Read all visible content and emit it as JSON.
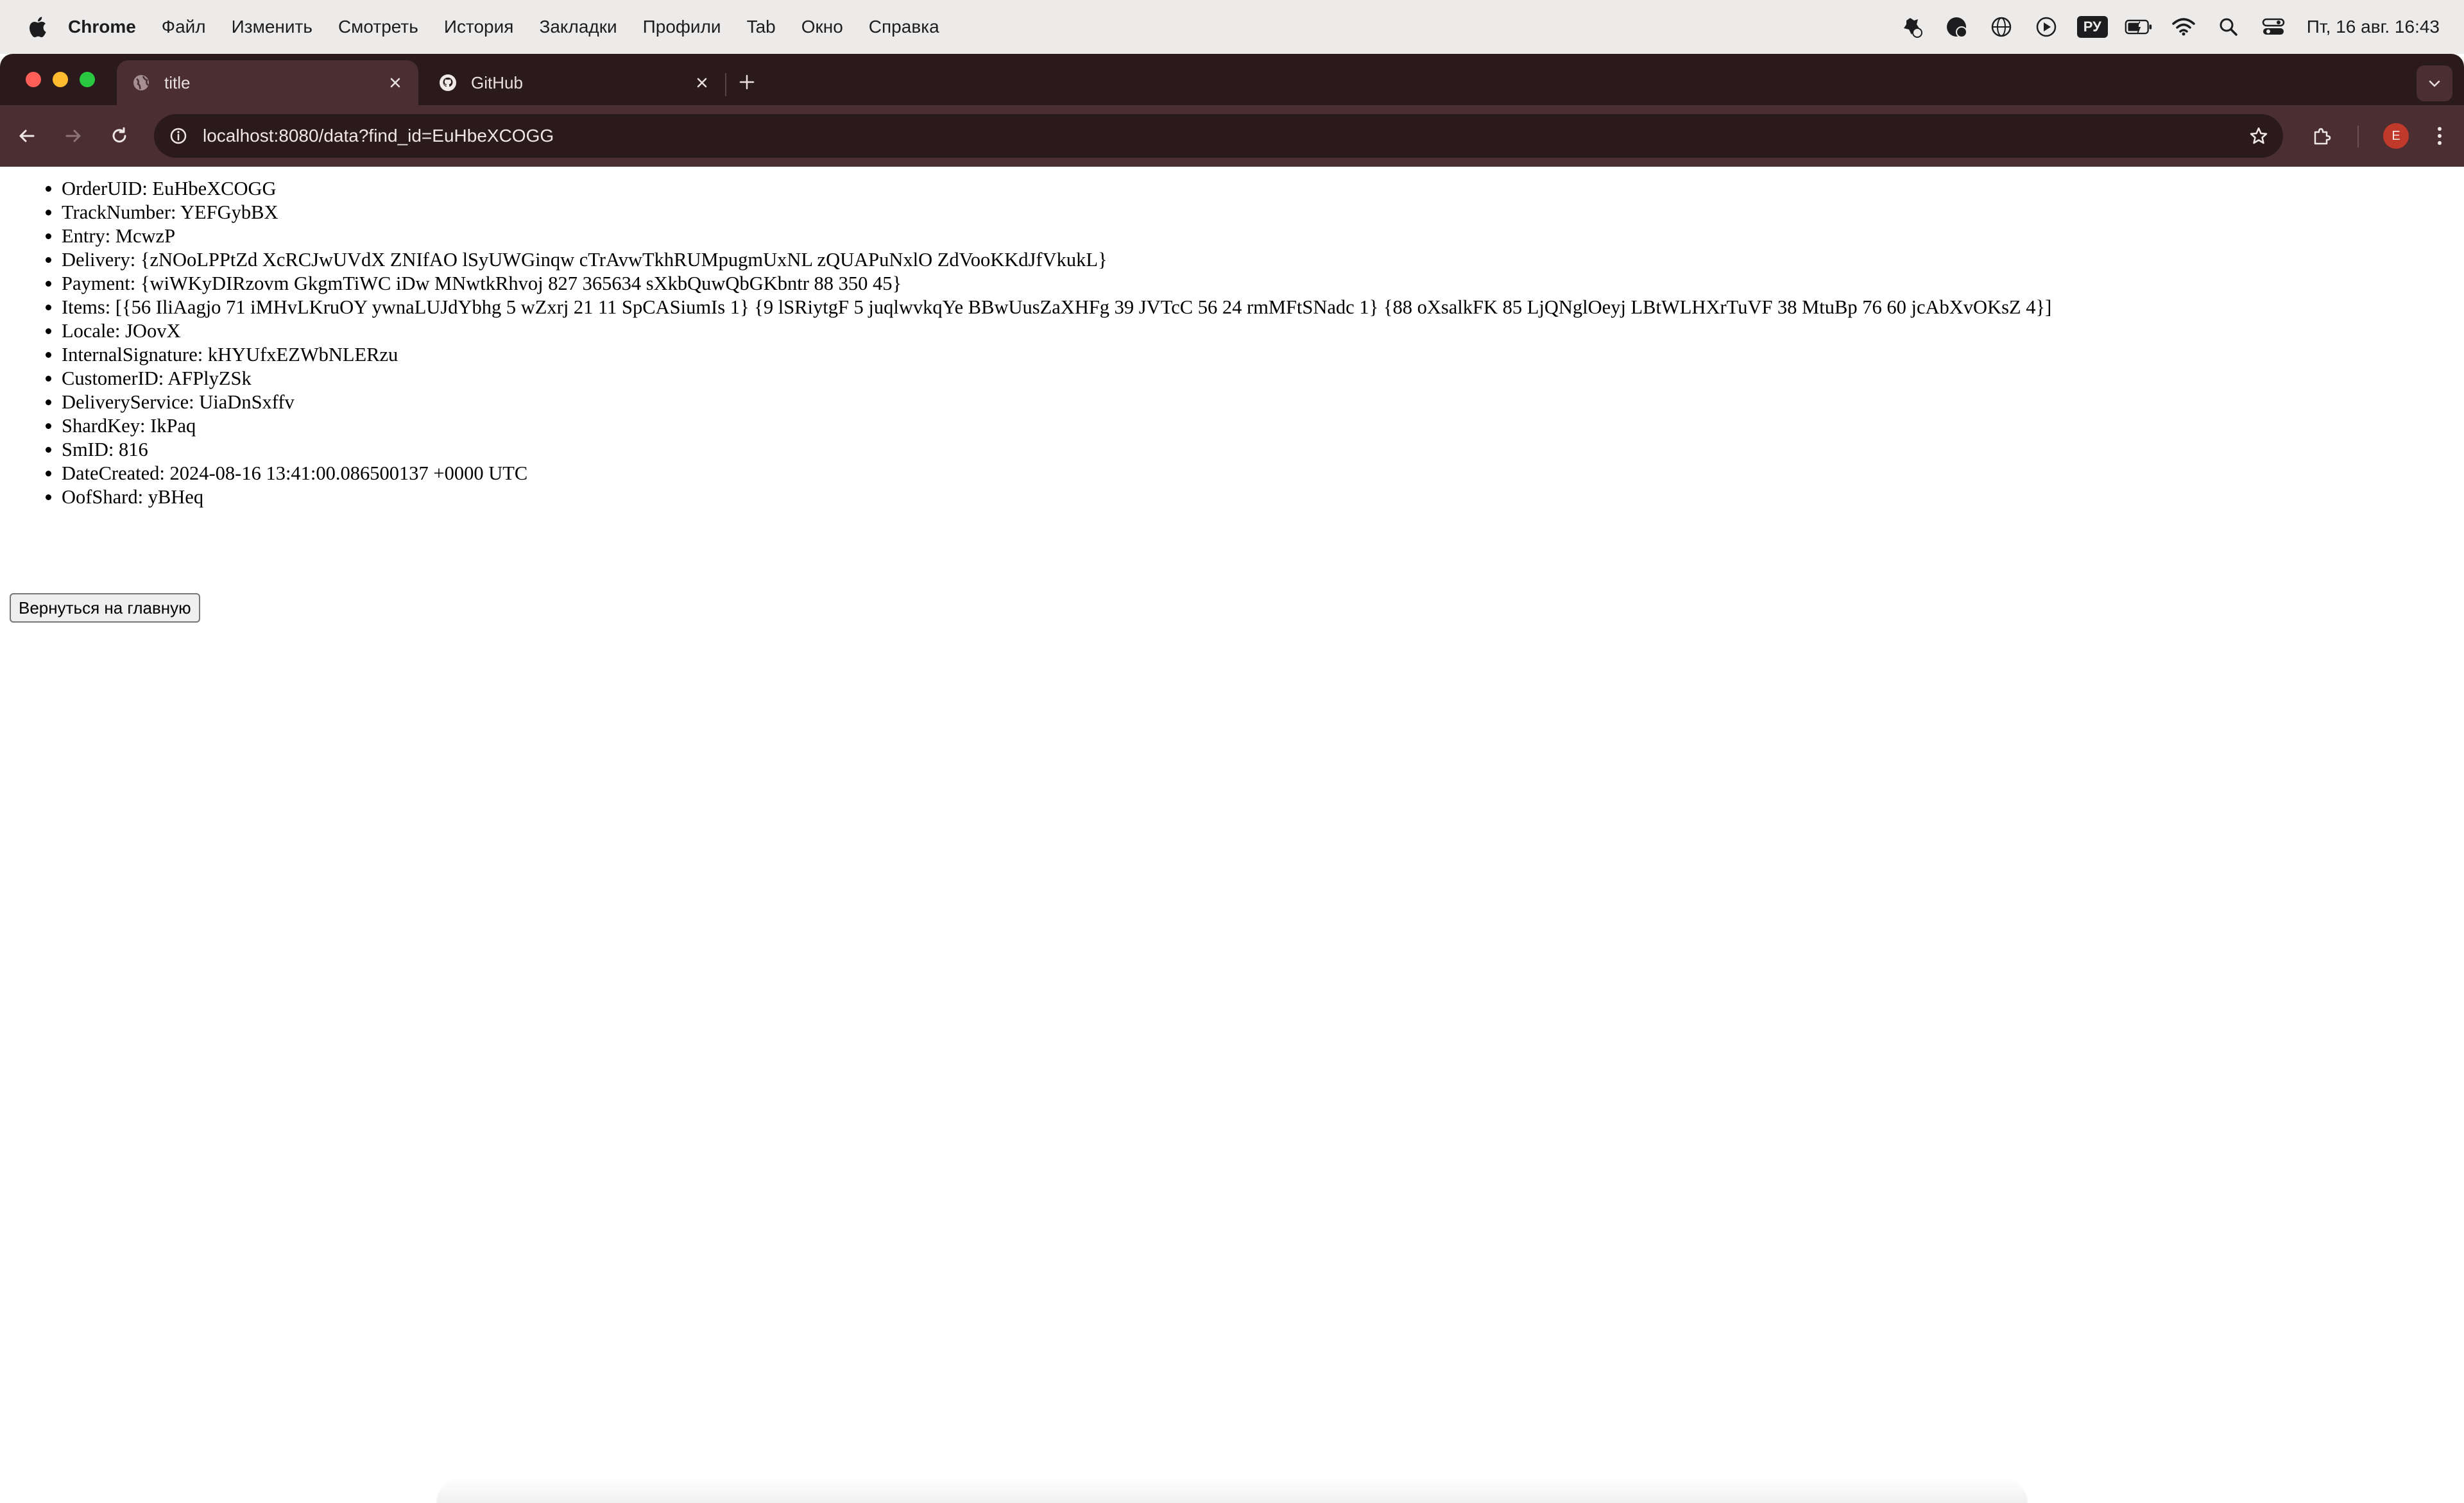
{
  "menubar": {
    "app_name": "Chrome",
    "items": [
      "Файл",
      "Изменить",
      "Смотреть",
      "История",
      "Закладки",
      "Профили",
      "Tab",
      "Окно",
      "Справка"
    ],
    "status": {
      "language": "РУ",
      "clock": "Пт, 16 авг.  16:43",
      "icons": [
        "app-status-icon",
        "notification-icon",
        "vpn-globe-icon",
        "play-icon",
        "language-icon",
        "battery-icon",
        "wifi-icon",
        "spotlight-search-icon",
        "control-center-icon"
      ]
    }
  },
  "browser": {
    "tabs": [
      {
        "title": "title",
        "favicon": "globe-icon",
        "active": true
      },
      {
        "title": "GitHub",
        "favicon": "github-icon",
        "active": false
      }
    ],
    "address_bar": {
      "url": "localhost:8080/data?find_id=EuHbeXCOGG"
    },
    "profile_initial": "E",
    "colors": {
      "frame": "#2b1a1c",
      "toolbar": "#4a2e31",
      "profile": "#c0392b"
    }
  },
  "page": {
    "fields": [
      "OrderUID: EuHbeXCOGG",
      "TrackNumber: YEFGybBX",
      "Entry: McwzP",
      "Delivery: {zNOoLPPtZd XcRCJwUVdX ZNIfAO lSyUWGinqw cTrAvwTkhRUMpugmUxNL zQUAPuNxlO ZdVooKKdJfVkukL}",
      "Payment: {wiWKyDIRzovm GkgmTiWC iDw MNwtkRhvoj 827 365634 sXkbQuwQbGKbntr 88 350 45}",
      "Items: [{56 IliAagjo 71 iMHvLKruOY ywnaLUJdYbhg 5 wZxrj 21 11 SpCASiumIs 1} {9 lSRiytgF 5 juqlwvkqYe BBwUusZaXHFg 39 JVTcC 56 24 rmMFtSNadc 1} {88 oXsalkFK 85 LjQNglOeyj LBtWLHXrTuVF 38 MtuBp 76 60 jcAbXvOKsZ 4}]",
      "Locale: JOovX",
      "InternalSignature: kHYUfxEZWbNLERzu",
      "CustomerID: AFPlyZSk",
      "DeliveryService: UiaDnSxffv",
      "ShardKey: IkPaq",
      "SmID: 816",
      "DateCreated: 2024-08-16 13:41:00.086500137 +0000 UTC",
      "OofShard: yBHeq"
    ],
    "back_button": "Вернуться на главную"
  }
}
